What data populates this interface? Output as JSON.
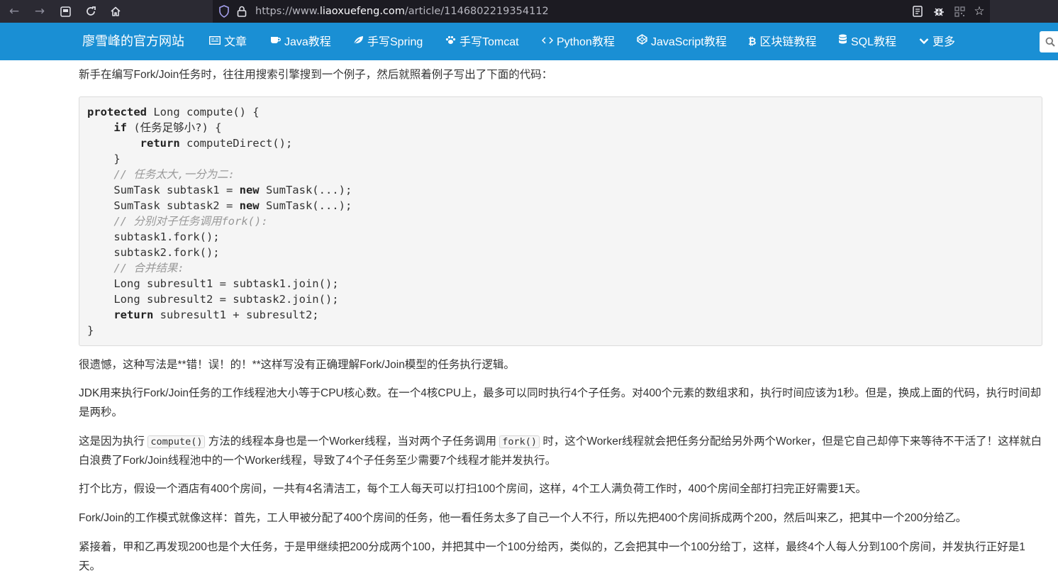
{
  "browser": {
    "url_prefix": "https://www.",
    "url_domain": "liaoxuefeng.com",
    "url_path": "/article/1146802219354112"
  },
  "site": {
    "brand": "廖雪峰的官方网站",
    "nav": [
      "文章",
      "Java教程",
      "手写Spring",
      "手写Tomcat",
      "Python教程",
      "JavaScript教程",
      "区块链教程",
      "SQL教程",
      "更多"
    ]
  },
  "article": {
    "intro": "新手在编写Fork/Join任务时，往往用搜索引擎搜到一个例子，然后就照着例子写出了下面的代码：",
    "code": {
      "l1_kw": "protected",
      "l1": " Long compute() {",
      "l2_kw": "if",
      "l2": " (任务足够小?) {",
      "l3_kw": "return",
      "l3": " computeDirect();",
      "l4": "}",
      "l5": "// 任务太大,一分为二:",
      "l6a": "SumTask subtask1 = ",
      "l6_kw": "new",
      "l6b": " SumTask(...);",
      "l7a": "SumTask subtask2 = ",
      "l7_kw": "new",
      "l7b": " SumTask(...);",
      "l8": "// 分别对子任务调用fork():",
      "l9": "subtask1.fork();",
      "l10": "subtask2.fork();",
      "l11": "// 合并结果:",
      "l12": "Long subresult1 = subtask1.join();",
      "l13": "Long subresult2 = subtask2.join();",
      "l14_kw": "return",
      "l14": " subresult1 + subresult2;",
      "l15": "}"
    },
    "p1": "很遗憾，这种写法是**错！误！的！**这样写没有正确理解Fork/Join模型的任务执行逻辑。",
    "p2": "JDK用来执行Fork/Join任务的工作线程池大小等于CPU核心数。在一个4核CPU上，最多可以同时执行4个子任务。对400个元素的数组求和，执行时间应该为1秒。但是，换成上面的代码，执行时间却是两秒。",
    "p3a": "这是因为执行 ",
    "p3_code1": "compute()",
    "p3b": " 方法的线程本身也是一个Worker线程，当对两个子任务调用 ",
    "p3_code2": "fork()",
    "p3c": " 时，这个Worker线程就会把任务分配给另外两个Worker，但是它自己却停下来等待不干活了！这样就白白浪费了Fork/Join线程池中的一个Worker线程，导致了4个子任务至少需要7个线程才能并发执行。",
    "p4": "打个比方，假设一个酒店有400个房间，一共有4名清洁工，每个工人每天可以打扫100个房间，这样，4个工人满负荷工作时，400个房间全部打扫完正好需要1天。",
    "p5": "Fork/Join的工作模式就像这样：首先，工人甲被分配了400个房间的任务，他一看任务太多了自己一个人不行，所以先把400个房间拆成两个200，然后叫来乙，把其中一个200分给乙。",
    "p6": "紧接着，甲和乙再发现200也是个大任务，于是甲继续把200分成两个100，并把其中一个100分给丙，类似的，乙会把其中一个100分给丁，这样，最终4个人每人分到100个房间，并发执行正好是1天。"
  }
}
